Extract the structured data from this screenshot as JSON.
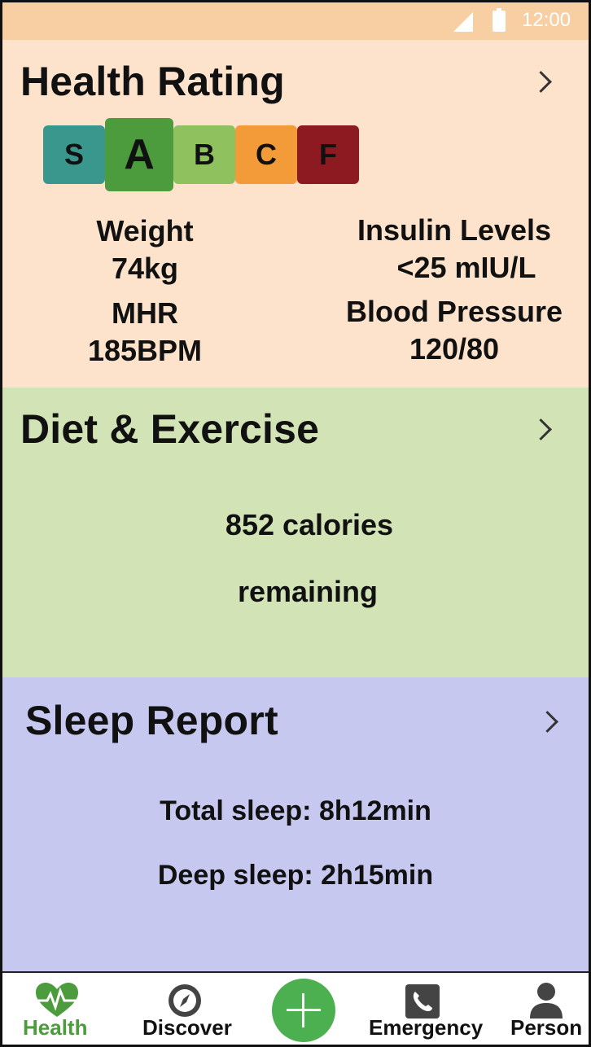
{
  "status_bar": {
    "time": "12:00"
  },
  "health_rating": {
    "title": "Health Rating",
    "grades": [
      {
        "label": "S",
        "color": "#3a978d",
        "selected": false
      },
      {
        "label": "A",
        "color": "#4c9c3d",
        "selected": true
      },
      {
        "label": "B",
        "color": "#8fc25e",
        "selected": false
      },
      {
        "label": "C",
        "color": "#f29b38",
        "selected": false
      },
      {
        "label": "F",
        "color": "#8c1a20",
        "selected": false
      }
    ],
    "weight_label": "Weight",
    "weight_value": "74kg",
    "mhr_label": "MHR",
    "mhr_value": "185BPM",
    "insulin_label": "Insulin Levels",
    "insulin_value": "<25 mIU/L",
    "bp_label": "Blood Pressure",
    "bp_value": "120/80"
  },
  "diet_exercise": {
    "title": "Diet & Exercise",
    "calories_line": "852 calories",
    "remaining_line": "remaining"
  },
  "sleep_report": {
    "title": "Sleep Report",
    "total_sleep": "Total sleep: 8h12min",
    "deep_sleep": "Deep sleep: 2h15min"
  },
  "nav": {
    "health": "Health",
    "discover": "Discover",
    "emergency": "Emergency",
    "person": "Person",
    "active_color": "#4c9c3d"
  },
  "colors": {
    "health_bg": "#fde3cb",
    "diet_bg": "#d2e4b5",
    "sleep_bg": "#c6c8ef",
    "status_bg": "#f8cfa3"
  },
  "icons": [
    "signal-icon",
    "battery-icon",
    "heart-pulse-icon",
    "compass-icon",
    "plus-icon",
    "phone-icon",
    "person-icon",
    "chevron-right-icon"
  ]
}
